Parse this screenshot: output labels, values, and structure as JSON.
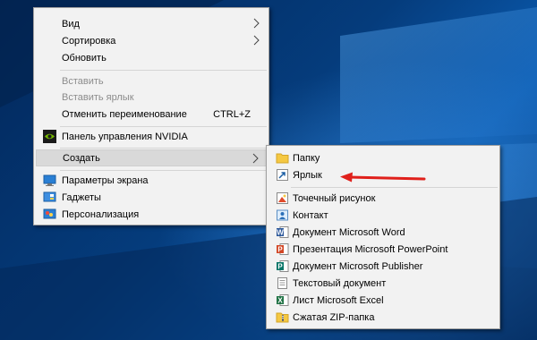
{
  "context_menu": {
    "items": [
      {
        "label": "Вид"
      },
      {
        "label": "Сортировка"
      },
      {
        "label": "Обновить"
      },
      {
        "label": "Вставить"
      },
      {
        "label": "Вставить ярлык"
      },
      {
        "label": "Отменить переименование",
        "shortcut": "CTRL+Z"
      },
      {
        "label": "Панель управления NVIDIA",
        "icon": "nvidia-icon"
      },
      {
        "label": "Создать"
      },
      {
        "label": "Параметры экрана",
        "icon": "display-settings-icon"
      },
      {
        "label": "Гаджеты",
        "icon": "gadgets-icon"
      },
      {
        "label": "Персонализация",
        "icon": "personalization-icon"
      }
    ]
  },
  "create_submenu": {
    "items": [
      {
        "label": "Папку",
        "icon": "folder-icon"
      },
      {
        "label": "Ярлык",
        "icon": "shortcut-icon"
      },
      {
        "label": "Точечный рисунок",
        "icon": "bitmap-icon"
      },
      {
        "label": "Контакт",
        "icon": "contact-icon"
      },
      {
        "label": "Документ Microsoft Word",
        "icon": "word-icon"
      },
      {
        "label": "Презентация Microsoft PowerPoint",
        "icon": "powerpoint-icon"
      },
      {
        "label": "Документ Microsoft Publisher",
        "icon": "publisher-icon"
      },
      {
        "label": "Текстовый документ",
        "icon": "text-document-icon"
      },
      {
        "label": "Лист Microsoft Excel",
        "icon": "excel-icon"
      },
      {
        "label": "Сжатая ZIP-папка",
        "icon": "zip-folder-icon"
      }
    ]
  },
  "colors": {
    "menu_background": "#f2f2f2",
    "highlight": "#d9d9d9",
    "disabled_text": "#8c8c8c",
    "annotation_arrow": "#e0201b",
    "desktop": "#053c7c"
  }
}
